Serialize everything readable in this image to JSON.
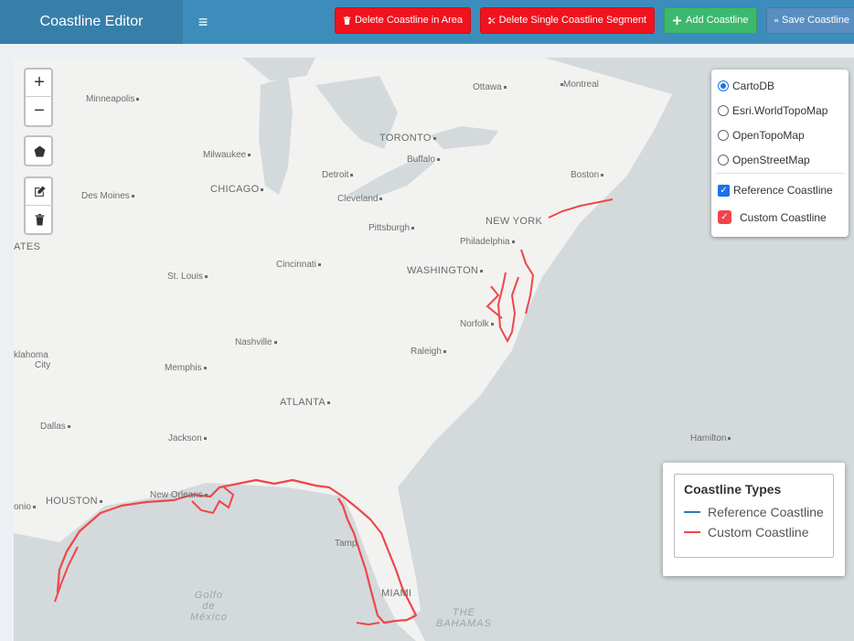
{
  "header": {
    "title": "Coastline Editor",
    "buttons": {
      "delete_area": "Delete Coastline in Area",
      "delete_segment": "Delete Single Coastline Segment",
      "add": "Add Coastline",
      "save": "Save Coastline"
    }
  },
  "zoom": {
    "in": "+",
    "out": "−"
  },
  "layers": {
    "basemaps": [
      "CartoDB",
      "Esri.WorldTopoMap",
      "OpenTopoMap",
      "OpenStreetMap"
    ],
    "selected_basemap": "CartoDB",
    "overlays": [
      "Reference Coastline",
      "Custom Coastline"
    ]
  },
  "legend": {
    "title": "Coastline Types",
    "items": [
      {
        "label": "Reference Coastline",
        "color": "#2c7bb6"
      },
      {
        "label": "Custom Coastline",
        "color": "#f0454b"
      }
    ]
  },
  "map": {
    "labels": {
      "minneapolis": "Minneapolis",
      "milwaukee": "Milwaukee",
      "chicago": "CHICAGO",
      "des_moines": "Des Moines",
      "detroit": "Detroit",
      "toronto": "TORONTO",
      "ottawa": "Ottawa",
      "montreal": "Montreal",
      "buffalo": "Buffalo",
      "cleveland": "Cleveland",
      "boston": "Boston",
      "new_york": "NEW YORK",
      "pittsburgh": "Pittsburgh",
      "philadelphia": "Philadelphia",
      "washington": "WASHINGTON",
      "cincinnati": "Cincinnati",
      "st_louis": "St. Louis",
      "ates": "ATES",
      "norfolk": "Norfolk",
      "nashville": "Nashville",
      "raleigh": "Raleigh",
      "oklahoma": "klahoma",
      "city": "City",
      "memphis": "Memphis",
      "atlanta": "ATLANTA",
      "dallas": "Dallas",
      "jackson": "Jackson",
      "hamilton": "Hamilton",
      "houston": "HOUSTON",
      "new_orleans": "New Orleans",
      "onio": "onio",
      "tampa": "Tamp",
      "miami": "MIAMI",
      "golfo": "Golfo",
      "de": "de",
      "mexico": "México",
      "the": "THE",
      "bahamas": "BAHAMAS"
    },
    "colors": {
      "land": "#f2f2f0",
      "water": "#d4dadc",
      "coastline": "#f0454b"
    }
  }
}
